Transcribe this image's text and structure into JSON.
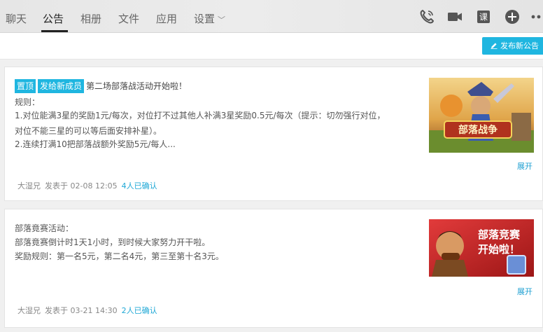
{
  "nav": {
    "tabs": [
      {
        "label": "聊天",
        "active": false
      },
      {
        "label": "公告",
        "active": true
      },
      {
        "label": "相册",
        "active": false
      },
      {
        "label": "文件",
        "active": false
      },
      {
        "label": "应用",
        "active": false
      },
      {
        "label": "设置",
        "active": false
      }
    ],
    "settings_chevron": "﹀",
    "icons": [
      "phone-icon",
      "video-icon",
      "lesson-icon",
      "add-icon",
      "more-icon"
    ],
    "lesson_glyph": "课"
  },
  "toolbar": {
    "publish_label": "发布新公告",
    "publish_icon": "pen-icon"
  },
  "announcements": [
    {
      "tags": [
        "置顶",
        "发给新成员"
      ],
      "title": "第二场部落战活动开始啦！",
      "lines": [
        "规则：",
        "1.对位能满3星的奖励1元/每次，对位打不过其他人补满3星奖励0.5元/每次（提示：切勿强行对位，",
        "对位不能三星的可以等后面安排补星）。",
        "2.连续打满10把部落战额外奖励5元/每人..."
      ],
      "author": "大湿兄",
      "posted": "发表于 02-08 12:05",
      "confirmed": "4人已确认",
      "expand_label": "展开",
      "image_text": "部落战争"
    },
    {
      "tags": [],
      "title": "",
      "lines": [
        "部落竟赛活动：",
        "部落竟赛倒计时1天1小时，到时候大家努力开干啦。",
        "奖励规则：第一名5元，第二名4元，第三至第十名3元。"
      ],
      "author": "大湿兄",
      "posted": "发表于 03-21 14:30",
      "confirmed": "2人已确认",
      "expand_label": "展开",
      "image_text": [
        "部落竞赛",
        "开始啦！"
      ]
    }
  ],
  "colors": {
    "accent": "#1fb6e0",
    "link": "#1fa0d2",
    "topbar": "#e8e8e8"
  }
}
